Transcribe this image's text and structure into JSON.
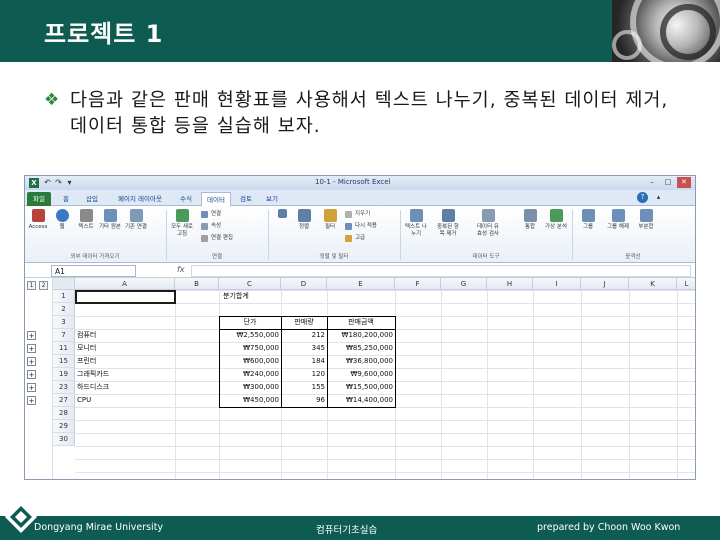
{
  "slide": {
    "title": "프로젝트 1",
    "bullet": "다음과 같은 판매 현황표를 사용해서 텍스트 나누기, 중복된 데이터 제거, 데이터 통합 등을 실습해 보자."
  },
  "excel": {
    "window_title": "10-1 - Microsoft Excel",
    "qat": [
      "↶",
      "↷",
      "▾"
    ],
    "window_controls": [
      "–",
      "□",
      "✕"
    ],
    "tabs": [
      "파일",
      "홈",
      "삽입",
      "페이지 레이아웃",
      "수식",
      "데이터",
      "검토",
      "보기"
    ],
    "active_tab": "데이터",
    "ribbon": {
      "buttons": [
        {
          "label": "Access",
          "icon": "access-icon",
          "color": "#b8433a"
        },
        {
          "label": "웹",
          "icon": "web-icon",
          "color": "#3a78c2"
        },
        {
          "label": "텍스트",
          "icon": "text-file-icon",
          "color": "#8a8a8a"
        },
        {
          "label": "기타 원본",
          "icon": "other-sources-icon",
          "color": "#6d8fb8"
        },
        {
          "label": "기존 연결",
          "icon": "existing-connections-icon",
          "color": "#7f9ab8"
        },
        {
          "label": "모두 새로 고침",
          "icon": "refresh-all-icon",
          "color": "#4b9a5a"
        },
        {
          "label": "정렬",
          "icon": "sort-icon",
          "color": "#5f7fa8"
        },
        {
          "label": "필터",
          "icon": "filter-icon",
          "color": "#d1a23a"
        },
        {
          "label": "텍스트 나누기",
          "icon": "text-to-columns-icon",
          "color": "#6d8fb8"
        },
        {
          "label": "중복된 항목 제거",
          "icon": "remove-duplicates-icon",
          "color": "#5f7fa8"
        },
        {
          "label": "데이터 유효성 검사",
          "icon": "data-validation-icon",
          "color": "#8a9bb1"
        },
        {
          "label": "통합",
          "icon": "consolidate-icon",
          "color": "#7a8fa8"
        },
        {
          "label": "가상 분석",
          "icon": "what-if-icon",
          "color": "#4b9a5a"
        },
        {
          "label": "그룹",
          "icon": "group-icon",
          "color": "#6d8fb8"
        },
        {
          "label": "그룹 해제",
          "icon": "ungroup-icon",
          "color": "#6d8fb8"
        },
        {
          "label": "부분합",
          "icon": "subtotal-icon",
          "color": "#6d8fb8"
        }
      ],
      "small_buttons": [
        {
          "label": "연결",
          "color": "#6d8fb8"
        },
        {
          "label": "속성",
          "color": "#8a9bb1"
        },
        {
          "label": "연결 편집",
          "color": "#a0a0a0"
        },
        {
          "label": "지우기",
          "color": "#b0b0b0"
        },
        {
          "label": "다시 적용",
          "color": "#6d8fb8"
        },
        {
          "label": "고급",
          "color": "#d1a23a"
        }
      ],
      "groups": [
        "외부 데이터 가져오기",
        "연결",
        "정렬 및 필터",
        "데이터 도구",
        "윤곽선"
      ]
    },
    "name_box": "A1",
    "fx": "fx",
    "outline_levels": [
      "1",
      "2"
    ],
    "columns": [
      "A",
      "B",
      "C",
      "D",
      "E",
      "F",
      "G",
      "H",
      "I",
      "J",
      "K",
      "L"
    ],
    "rows": [
      "1",
      "2",
      "3",
      "7",
      "11",
      "15",
      "19",
      "23",
      "27",
      "28",
      "29",
      "30"
    ],
    "outline_buttons": [
      "+",
      "+",
      "+",
      "+",
      "+",
      "+"
    ],
    "sheet": {
      "title": "분기합계",
      "headers": [
        "단가",
        "판매량",
        "판매금액"
      ],
      "items": [
        {
          "name": "컴퓨터",
          "price": "₩2,550,000",
          "qty": "212",
          "amount": "₩180,200,000"
        },
        {
          "name": "모니터",
          "price": "₩750,000",
          "qty": "345",
          "amount": "₩85,250,000"
        },
        {
          "name": "프린터",
          "price": "₩600,000",
          "qty": "184",
          "amount": "₩36,800,000"
        },
        {
          "name": "그래픽카드",
          "price": "₩240,000",
          "qty": "120",
          "amount": "₩9,600,000"
        },
        {
          "name": "하드디스크",
          "price": "₩300,000",
          "qty": "155",
          "amount": "₩15,500,000"
        },
        {
          "name": "CPU",
          "price": "₩450,000",
          "qty": "96",
          "amount": "₩14,400,000"
        }
      ]
    }
  },
  "footer": {
    "left": "Dongyang Mirae University",
    "center": "컴퓨터기초실습",
    "right": "prepared by Choon Woo Kwon"
  }
}
